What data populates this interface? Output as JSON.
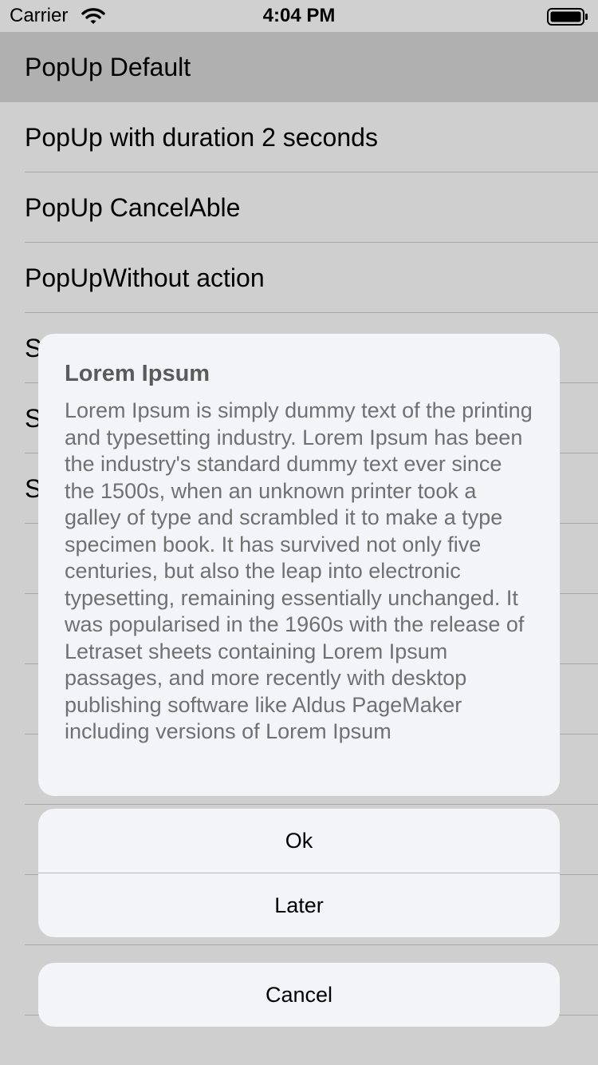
{
  "status_bar": {
    "carrier": "Carrier",
    "time": "4:04 PM",
    "wifi_icon": "wifi-icon",
    "battery_icon": "battery-icon"
  },
  "list": {
    "items": [
      {
        "label": "PopUp Default"
      },
      {
        "label": "PopUp with duration 2 seconds"
      },
      {
        "label": "PopUp CancelAble"
      },
      {
        "label": "PopUpWithout action"
      },
      {
        "label": "S"
      },
      {
        "label": "S"
      },
      {
        "label": "S"
      }
    ]
  },
  "popup": {
    "title": "Lorem Ipsum",
    "message": "Lorem Ipsum is simply dummy text of the printing and typesetting industry. Lorem Ipsum has been the industry's standard dummy text ever since the 1500s, when an unknown printer took a galley of type and scrambled it to make a type specimen book. It has survived not only five centuries, but also the leap into electronic typesetting, remaining essentially unchanged. It was popularised in the 1960s with the release of Letraset sheets containing Lorem Ipsum passages, and more recently with desktop publishing software like Aldus PageMaker including versions of Lorem Ipsum",
    "actions": {
      "ok": "Ok",
      "later": "Later",
      "cancel": "Cancel"
    }
  },
  "colors": {
    "background": "#cfcfcf",
    "highlight": "#b0b0b0",
    "card": "#f3f4f8",
    "title": "#5a5a5a",
    "message": "#707070"
  }
}
